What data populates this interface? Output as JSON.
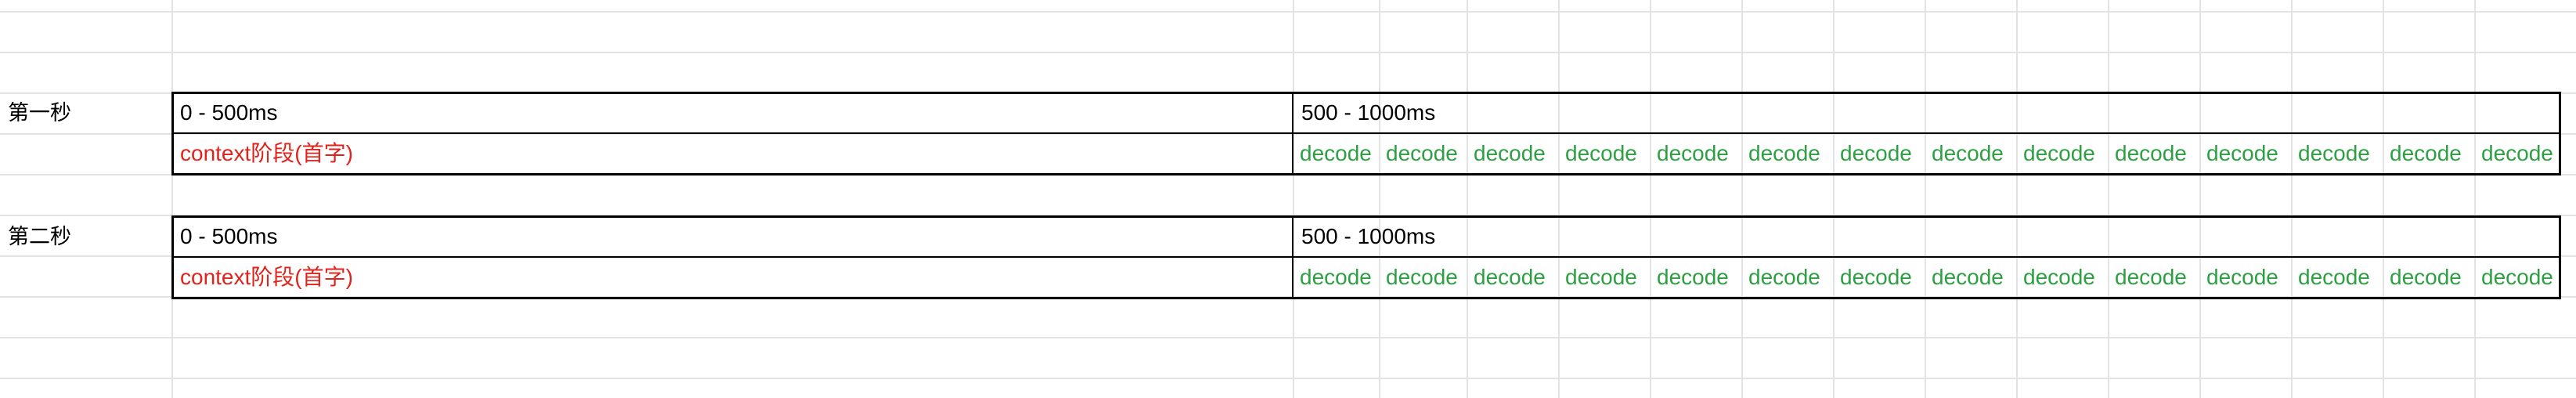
{
  "blocks": [
    {
      "label": "第一秒",
      "range_first": "0 - 500ms",
      "range_second": "500 - 1000ms",
      "context_stage": "context阶段(首字)",
      "decode_cells": [
        "decode",
        "decode",
        "decode",
        "decode",
        "decode",
        "decode",
        "decode",
        "decode",
        "decode",
        "decode",
        "decode",
        "decode",
        "decode",
        "decode"
      ]
    },
    {
      "label": "第二秒",
      "range_first": "0 - 500ms",
      "range_second": "500 - 1000ms",
      "context_stage": "context阶段(首字)",
      "decode_cells": [
        "decode",
        "decode",
        "decode",
        "decode",
        "decode",
        "decode",
        "decode",
        "decode",
        "decode",
        "decode",
        "decode",
        "decode",
        "decode",
        "decode"
      ]
    }
  ],
  "colors": {
    "context_text": "#e0231c",
    "decode_text": "#2ea043",
    "grid_line": "#e3e3e3",
    "table_border": "#000000"
  }
}
